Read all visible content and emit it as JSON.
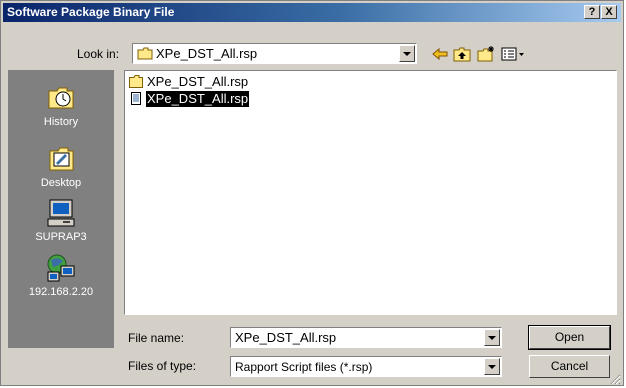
{
  "window": {
    "title": "Software Package Binary File"
  },
  "titlebar": {
    "help_label": "?",
    "close_label": "X"
  },
  "look_in": {
    "label": "Look in:",
    "value": "XPe_DST_All.rsp"
  },
  "toolbar": {
    "back_icon": "back-arrow-icon",
    "up_icon": "up-folder-icon",
    "new_folder_icon": "new-folder-icon",
    "views_icon": "views-menu-icon"
  },
  "places": [
    {
      "label": "History",
      "icon": "history-icon"
    },
    {
      "label": "Desktop",
      "icon": "desktop-icon"
    },
    {
      "label": "SUPRAP3",
      "icon": "computer-icon"
    },
    {
      "label": "192.168.2.20",
      "icon": "network-icon"
    }
  ],
  "files": [
    {
      "name": "XPe_DST_All.rsp",
      "type": "folder",
      "selected": false
    },
    {
      "name": "XPe_DST_All.rsp",
      "type": "file",
      "selected": true
    }
  ],
  "file_name": {
    "label": "File name:",
    "value": "XPe_DST_All.rsp"
  },
  "file_type": {
    "label": "Files of type:",
    "value": "Rapport Script files (*.rsp)"
  },
  "buttons": {
    "open": "Open",
    "cancel": "Cancel"
  },
  "colors": {
    "title_start": "#0a246a",
    "title_end": "#a6caf0",
    "face": "#d4d0c8",
    "places_bg": "#808080"
  }
}
